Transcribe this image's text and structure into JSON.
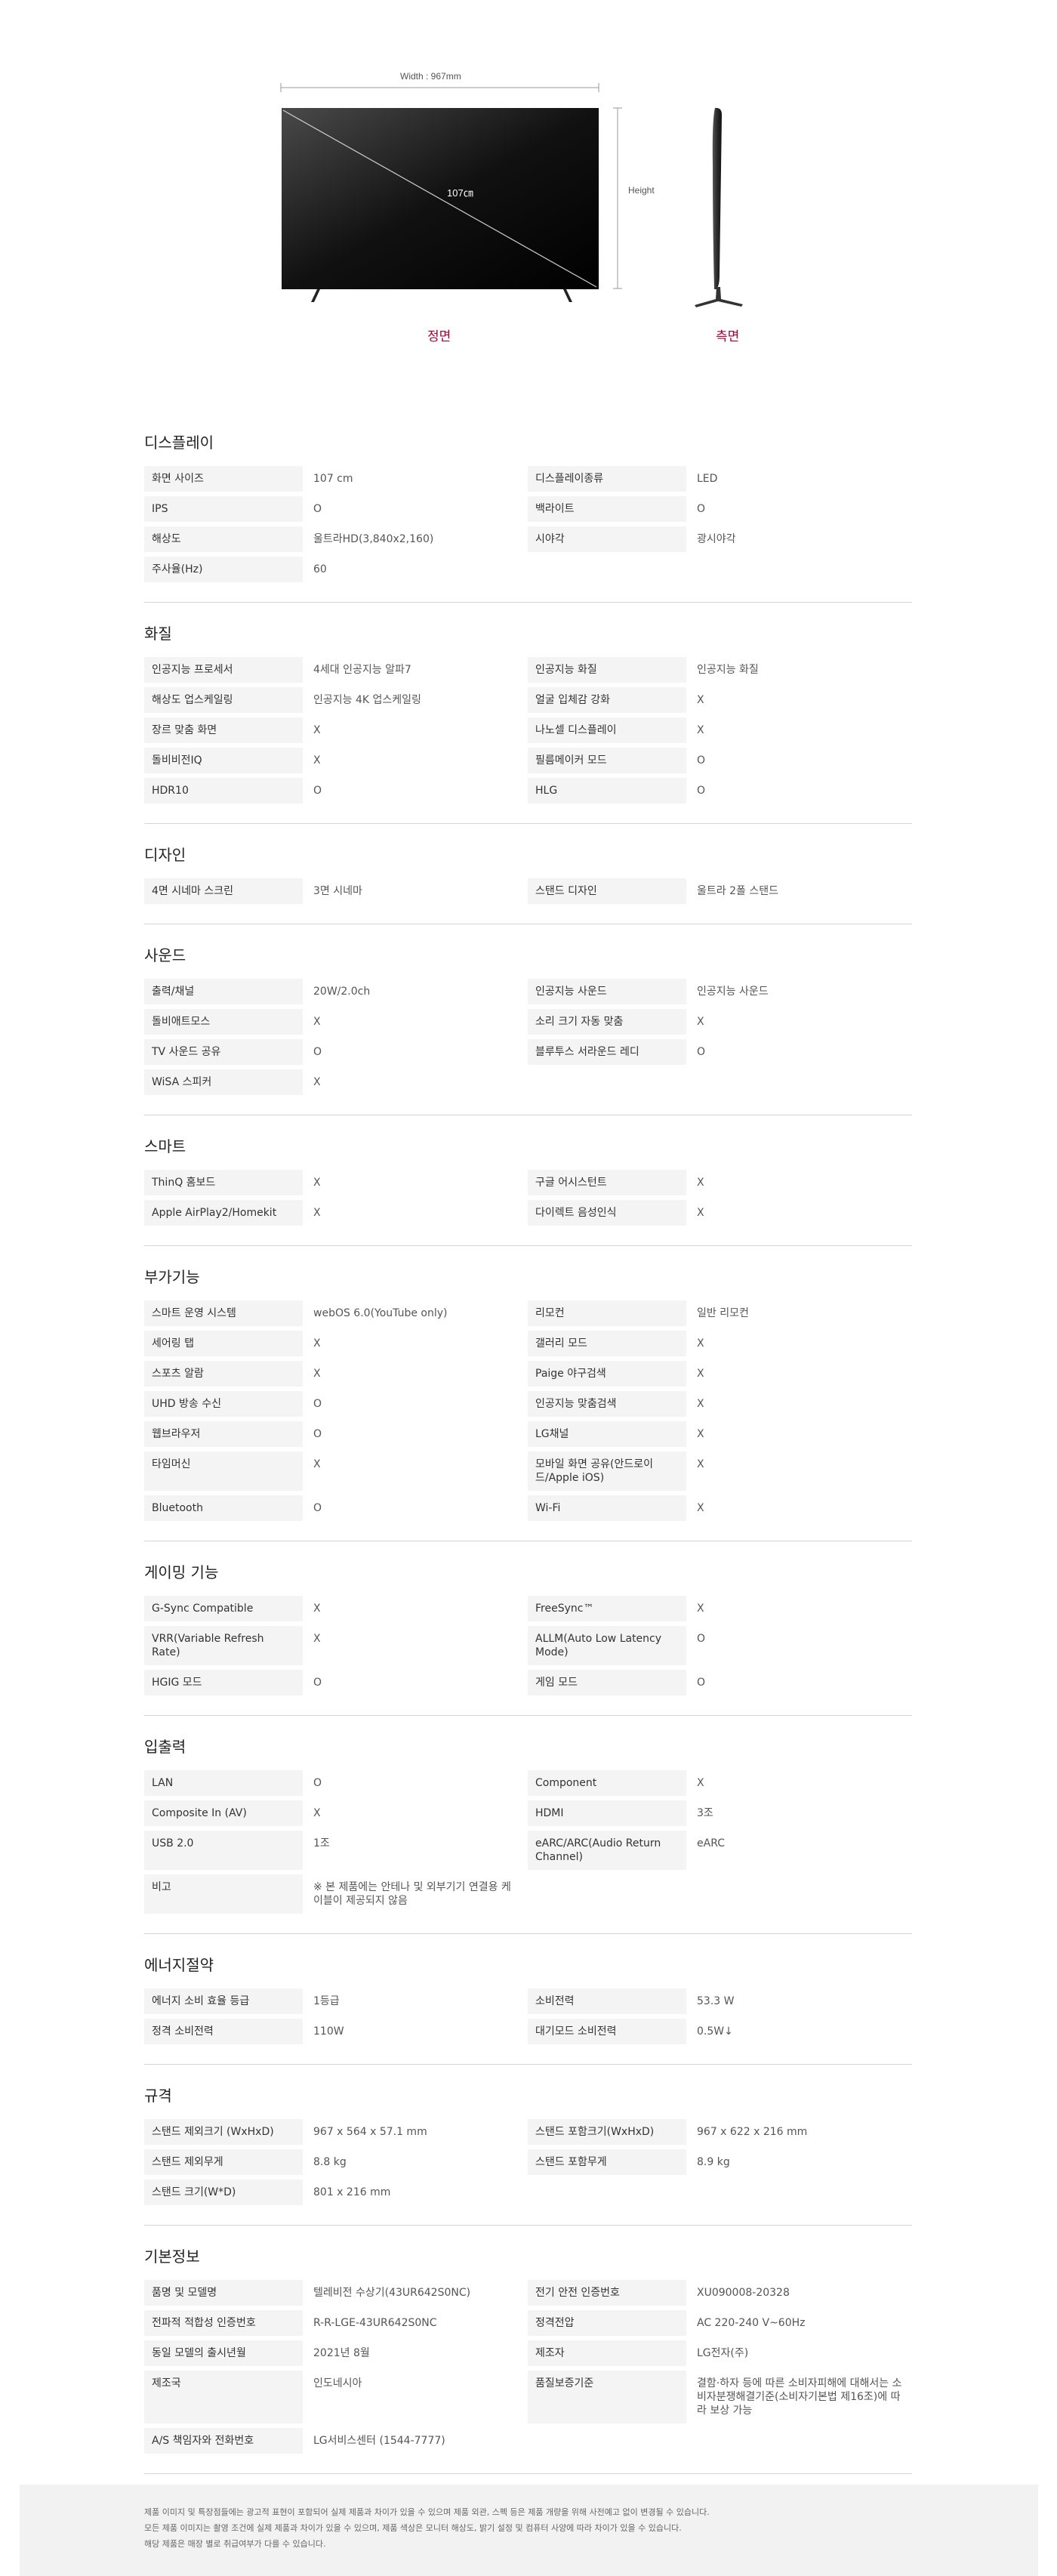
{
  "dimensions": {
    "width_label": "Width : 967mm",
    "height_label": "Height",
    "diagonal_label": "107㎝",
    "front_label": "정면",
    "side_label": "측면"
  },
  "sections": [
    {
      "title": "디스플레이",
      "rows": [
        [
          [
            "화면 사이즈",
            "107 cm"
          ],
          [
            "디스플레이종류",
            "LED"
          ]
        ],
        [
          [
            "IPS",
            "O"
          ],
          [
            "백라이트",
            "O"
          ]
        ],
        [
          [
            "해상도",
            "울트라HD(3,840x2,160)"
          ],
          [
            "시야각",
            "광시야각"
          ]
        ],
        [
          [
            "주사율(Hz)",
            "60"
          ]
        ]
      ]
    },
    {
      "title": "화질",
      "rows": [
        [
          [
            "인공지능 프로세서",
            "4세대 인공지능 알파7"
          ],
          [
            "인공지능 화질",
            "인공지능 화질"
          ]
        ],
        [
          [
            "해상도 업스케일링",
            "인공지능 4K 업스케일링"
          ],
          [
            "얼굴 입체감 강화",
            "X"
          ]
        ],
        [
          [
            "장르 맞춤 화면",
            "X"
          ],
          [
            "나노셀 디스플레이",
            "X"
          ]
        ],
        [
          [
            "돌비비전IQ",
            "X"
          ],
          [
            "필름메이커 모드",
            "O"
          ]
        ],
        [
          [
            "HDR10",
            "O"
          ],
          [
            "HLG",
            "O"
          ]
        ]
      ]
    },
    {
      "title": "디자인",
      "rows": [
        [
          [
            "4면 시네마 스크린",
            "3면 시네마"
          ],
          [
            "스탠드 디자인",
            "울트라 2폴 스탠드"
          ]
        ]
      ]
    },
    {
      "title": "사운드",
      "rows": [
        [
          [
            "출력/채널",
            "20W/2.0ch"
          ],
          [
            "인공지능 사운드",
            "인공지능 사운드"
          ]
        ],
        [
          [
            "돌비애트모스",
            "X"
          ],
          [
            "소리 크기 자동 맞춤",
            "X"
          ]
        ],
        [
          [
            "TV 사운드 공유",
            "O"
          ],
          [
            "블루투스 서라운드 레디",
            "O"
          ]
        ],
        [
          [
            "WiSA 스피커",
            "X"
          ]
        ]
      ]
    },
    {
      "title": "스마트",
      "rows": [
        [
          [
            "ThinQ 홈보드",
            "X"
          ],
          [
            "구글 어시스턴트",
            "X"
          ]
        ],
        [
          [
            "Apple AirPlay2/Homekit",
            "X"
          ],
          [
            "다이렉트 음성인식",
            "X"
          ]
        ]
      ]
    },
    {
      "title": "부가기능",
      "rows": [
        [
          [
            "스마트 운영 시스템",
            "webOS 6.0(YouTube only)"
          ],
          [
            "리모컨",
            "일반 리모컨"
          ]
        ],
        [
          [
            "세어링 탭",
            "X"
          ],
          [
            "갤러리 모드",
            "X"
          ]
        ],
        [
          [
            "스포츠 알람",
            "X"
          ],
          [
            "Paige 야구검색",
            "X"
          ]
        ],
        [
          [
            "UHD 방송 수신",
            "O"
          ],
          [
            "인공지능 맞춤검색",
            "X"
          ]
        ],
        [
          [
            "웹브라우저",
            "O"
          ],
          [
            "LG채널",
            "X"
          ]
        ],
        [
          [
            "타임머신",
            "X"
          ],
          [
            "모바일 화면 공유(안드로이드/Apple iOS)",
            "X"
          ]
        ],
        [
          [
            "Bluetooth",
            "O"
          ],
          [
            "Wi-Fi",
            "X"
          ]
        ]
      ]
    },
    {
      "title": "게이밍 기능",
      "rows": [
        [
          [
            "G-Sync Compatible",
            "X"
          ],
          [
            "FreeSync™",
            "X"
          ]
        ],
        [
          [
            "VRR(Variable Refresh Rate)",
            "X"
          ],
          [
            "ALLM(Auto Low Latency Mode)",
            "O"
          ]
        ],
        [
          [
            "HGIG 모드",
            "O"
          ],
          [
            "게임 모드",
            "O"
          ]
        ]
      ]
    },
    {
      "title": "입출력",
      "rows": [
        [
          [
            "LAN",
            "O"
          ],
          [
            "Component",
            "X"
          ]
        ],
        [
          [
            "Composite In (AV)",
            "X"
          ],
          [
            "HDMI",
            "3조"
          ]
        ],
        [
          [
            "USB 2.0",
            "1조"
          ],
          [
            "eARC/ARC(Audio Return Channel)",
            "eARC"
          ]
        ],
        [
          [
            "비고",
            "※ 본 제품에는 안테나 및 외부기기 연결용 케이블이 제공되지 않음"
          ]
        ]
      ]
    },
    {
      "title": "에너지절약",
      "rows": [
        [
          [
            "에너지 소비 효율 등급",
            "1등급"
          ],
          [
            "소비전력",
            "53.3 W"
          ]
        ],
        [
          [
            "정격 소비전력",
            "110W"
          ],
          [
            "대기모드 소비전력",
            "0.5W↓"
          ]
        ]
      ]
    },
    {
      "title": "규격",
      "rows": [
        [
          [
            "스탠드 제외크기 (WxHxD)",
            "967 x 564 x 57.1 mm"
          ],
          [
            "스탠드 포함크기(WxHxD)",
            "967 x 622 x 216 mm"
          ]
        ],
        [
          [
            "스탠드 제외무게",
            "8.8 kg"
          ],
          [
            "스탠드 포함무게",
            "8.9 kg"
          ]
        ],
        [
          [
            "스탠드 크기(W*D)",
            "801 x 216 mm"
          ]
        ]
      ]
    },
    {
      "title": "기본정보",
      "rows": [
        [
          [
            "품명 및 모델명",
            "텔레비전 수상기(43UR642S0NC)"
          ],
          [
            "전기 안전 인증번호",
            "XU090008-20328"
          ]
        ],
        [
          [
            "전파적 적합성 인증번호",
            "R-R-LGE-43UR642S0NC"
          ],
          [
            "정격전압",
            "AC 220-240 V~60Hz"
          ]
        ],
        [
          [
            "동일 모델의 출시년월",
            "2021년 8월"
          ],
          [
            "제조자",
            "LG전자(주)"
          ]
        ],
        [
          [
            "제조국",
            "인도네시아"
          ],
          [
            "품질보증기준",
            "결함·하자 등에 따른 소비자피해에 대해서는 소비자분쟁해결기준(소비자기본법 제16조)에 따라 보상 가능"
          ]
        ],
        [
          [
            "A/S 책임자와 전화번호",
            "LG서비스센터 (1544-7777)"
          ]
        ]
      ]
    }
  ],
  "footer_notes": [
    "제품 이미지 및 특장점들에는 광고적 표현이 포함되어 실제 제품과 차이가 있을 수 있으며 제품 외관, 스펙 등은 제품 개량을 위해 사전예고 없이 변경될 수 있습니다.",
    "모든 제품 이미지는 촬영 조건에 실제 제품과 차이가 있을 수 있으며, 제품 색상은 모니터 해상도, 밝기 설정 및 컴퓨터 사양에 따라 차이가 있을 수 있습니다.",
    "해당 제품은 매장 별로 취급여부가 다를 수 있습니다."
  ]
}
